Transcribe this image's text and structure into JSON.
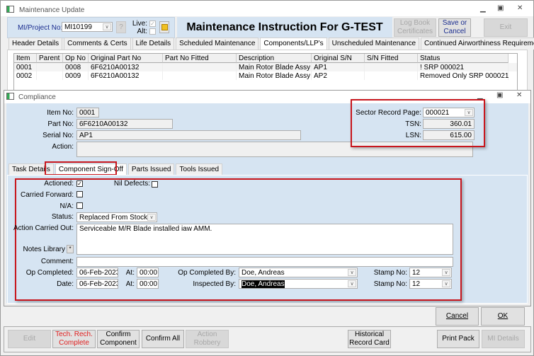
{
  "main_window": {
    "title": "Maintenance Update",
    "mi_label": "MI/Project No:",
    "mi_value": "MI10199",
    "help_label": "?",
    "live_label": "Live:",
    "alt_label": "Alt:",
    "heading": "Maintenance Instruction For G-TEST",
    "logbook_label": "Log Book Certificates",
    "save_cancel_label": "Save or Cancel",
    "exit_label": "Exit"
  },
  "tabs": [
    "Header Details",
    "Comments & Certs",
    "Life Details",
    "Scheduled Maintenance",
    "Components/LLP's",
    "Unscheduled Maintenance",
    "Continued Airworthiness Requirements"
  ],
  "grid": {
    "columns": [
      "Item",
      "Parent",
      "Op No",
      "Original Part No",
      "Part No Fitted",
      "Description",
      "Original S/N",
      "S/N Fitted",
      "Status"
    ],
    "rows": [
      [
        "0001",
        "",
        "0008",
        "6F6210A00132",
        "",
        "Main Rotor Blade Assy",
        "AP1",
        "",
        "!  SRP 000021"
      ],
      [
        "0002",
        "",
        "0009",
        "6F6210A00132",
        "",
        "Main Rotor Blade Assy",
        "AP2",
        "",
        "Removed Only SRP 000021"
      ]
    ]
  },
  "compliance": {
    "title": "Compliance",
    "item_label": "Item No:",
    "item": "0001",
    "part_label": "Part No:",
    "part": "6F6210A00132",
    "serial_label": "Serial No:",
    "serial": "AP1",
    "action_label": "Action:",
    "srp_label": "Sector Record Page:",
    "srp": "000021",
    "tsn_label": "TSN:",
    "tsn": "360.01",
    "lsn_label": "LSN:",
    "lsn": "615.00",
    "tabs": [
      "Task Details",
      "Component Sign-Off",
      "Parts Issued",
      "Tools Issued"
    ],
    "signoff": {
      "actioned_label": "Actioned:",
      "actioned": true,
      "nil_label": "Nil Defects:",
      "nil": false,
      "cf_label": "Carried Forward:",
      "cf": false,
      "na_label": "N/A:",
      "na": false,
      "status_label": "Status:",
      "status": "Replaced From Stock",
      "aco_label": "Action Carried Out:",
      "aco": "Serviceable M/R Blade installed iaw AMM.",
      "notes_label": "Notes Library",
      "notes_btn": "*",
      "comment_label": "Comment:",
      "comment": "",
      "opc_label": "Op Completed:",
      "opc_date": "06-Feb-2023",
      "at_label": "At:",
      "opc_time": "00:00",
      "date_label": "Date:",
      "date": "06-Feb-2023",
      "date_time": "00:00",
      "opby_label": "Op Completed By:",
      "opby": "Doe, Andreas",
      "insp_label": "Inspected By:",
      "insp": "Doe, Andreas",
      "stamp_label": "Stamp No:",
      "stamp1": "12",
      "stamp2": "12"
    },
    "cancel": "Cancel",
    "ok": "OK"
  },
  "bottom": {
    "edit": "Edit",
    "tech": "Tech. Rech. Complete",
    "confirm_comp": "Confirm Component",
    "confirm_all": "Confirm All",
    "robbery": "Action Robbery",
    "hist": "Historical Record Card",
    "print": "Print Pack",
    "mi_details": "MI Details"
  }
}
